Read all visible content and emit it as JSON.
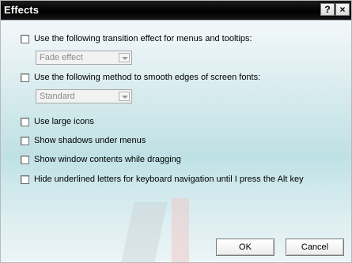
{
  "window": {
    "title": "Effects",
    "help_button": "?",
    "close_button": "×"
  },
  "options": [
    {
      "label": "Use the following transition effect for menus and tooltips:",
      "checked": false
    },
    {
      "label": "Use the following method to smooth edges of screen fonts:",
      "checked": false
    },
    {
      "label": "Use large icons",
      "checked": false
    },
    {
      "label": "Show shadows under menus",
      "checked": false
    },
    {
      "label": "Show window contents while dragging",
      "checked": false
    },
    {
      "label": "Hide underlined letters for keyboard navigation until I press the Alt key",
      "checked": false
    }
  ],
  "transition_select": {
    "value": "Fade effect"
  },
  "font_smoothing_select": {
    "value": "Standard"
  },
  "buttons": {
    "ok": "OK",
    "cancel": "Cancel"
  },
  "colors": {
    "title_bar": "#000000",
    "title_text": "#ffffff",
    "disabled_text": "#8b8b8b"
  }
}
